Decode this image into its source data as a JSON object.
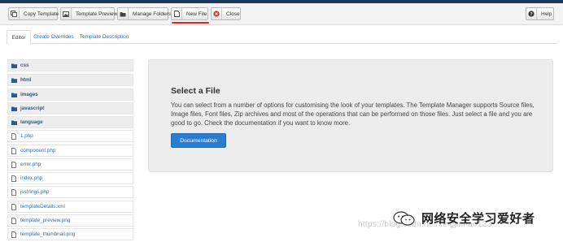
{
  "toolbar": {
    "copy_template": "Copy Template",
    "template_preview": "Template Preview",
    "manage_folders": "Manage Folders",
    "new_file": "New File",
    "close": "Close",
    "help": "Help"
  },
  "tabs": [
    "Editor",
    "Create Overrides",
    "Template Description"
  ],
  "tree": {
    "folders": [
      "css",
      "html",
      "images",
      "javascript",
      "language"
    ],
    "files": [
      "1.php",
      "component.php",
      "error.php",
      "index.php",
      "jsstrings.php",
      "templateDetails.xml",
      "template_preview.png",
      "template_thumbnail.png"
    ]
  },
  "panel": {
    "title": "Select a File",
    "body": "You can select from a number of options for customising the look of your templates. The Template Manager supports Source files, Image files, Font files, Zip archives and most of the operations that can be performed on those files. Just select a file and you are good to go. Check the documentation if you want to know more.",
    "button": "Documentation"
  },
  "watermark": {
    "text": "网络安全学习爱好者",
    "url": "https://blog.csdn.net/xingjinhao123"
  },
  "colors": {
    "accent": "#2a7cd3",
    "link": "#2a6fb0",
    "close_red": "#c9302c",
    "underline": "#d9262b"
  }
}
